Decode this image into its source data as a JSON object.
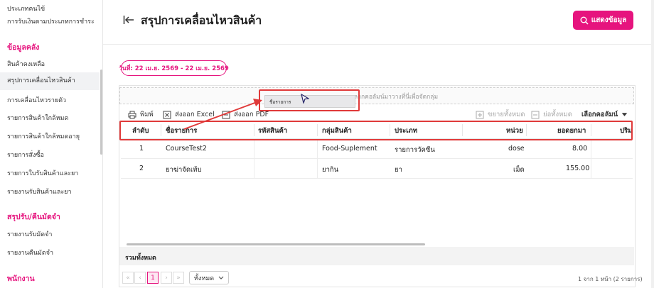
{
  "sidebar": {
    "items_top": [
      "ประเภทคนไข้",
      "การรับเงินตามประเภทการชำระ"
    ],
    "section_inventory": "ข้อมูลคลัง",
    "inventory_items": [
      "สินค้าคงเหลือ",
      "สรุปการเคลื่อนไหวสินค้า",
      "การเคลื่อนไหวรายตัว",
      "รายการสินค้าใกล้หมด",
      "รายการสินค้าใกล้หมดอายุ",
      "รายการสั่งซื้อ",
      "รายการใบรับสินค้าและยา",
      "รายงานรับสินค้าและยา"
    ],
    "section_deposit": "สรุปรับ/คืนมัดจำ",
    "deposit_items": [
      "รายงานรับมัดจำ",
      "รายงานคืนมัดจำ"
    ],
    "section_staff": "พนักงาน"
  },
  "header": {
    "title": "สรุปการเคลื่อนไหวสินค้า",
    "show_button": "แสดงข้อมูล"
  },
  "date_filter": "วันที่: 22 เม.ย. 2569 - 22 เม.ย. 2569",
  "grid": {
    "group_hint": "ลากคอลัมน์มาวางที่นี่เพื่อจัดกลุ่ม",
    "dragging_chip": "ชื่อรายการ",
    "toolbar": {
      "print": "พิมพ์",
      "export_excel": "ส่งออก Excel",
      "export_pdf": "ส่งออก PDF",
      "expand_all": "ขยายทั้งหมด",
      "collapse_all": "ย่อทั้งหมด",
      "choose_columns": "เลือกคอลัมน์"
    },
    "columns": [
      "ลำดับ",
      "ชื่อรายการ",
      "รหัสสินค้า",
      "กลุ่มสินค้า",
      "ประเภท",
      "หน่วย",
      "ยอดยกมา",
      "ปริม"
    ],
    "rows": [
      {
        "no": "1",
        "name": "CourseTest2",
        "code": "",
        "group": "Food-Suplement",
        "type": "รายการวัคซีน",
        "unit": "dose",
        "carried": "8.00"
      },
      {
        "no": "2",
        "name": "ยาฆ่าจัดเท้บ",
        "code": "",
        "group": "ยากิน",
        "type": "ยา",
        "unit": "เม็ด",
        "carried": "155.00"
      }
    ],
    "total_label": "รวมทั้งหมด"
  },
  "pager": {
    "first": "«",
    "prev": "‹",
    "current_page": "1",
    "next": "›",
    "last": "»",
    "page_size": "ทั้งหมด",
    "info": "1 จาก 1 หน้า (2 รายการ)"
  },
  "colors": {
    "accent": "#e6147e",
    "annotation_red": "#e03a3a"
  }
}
